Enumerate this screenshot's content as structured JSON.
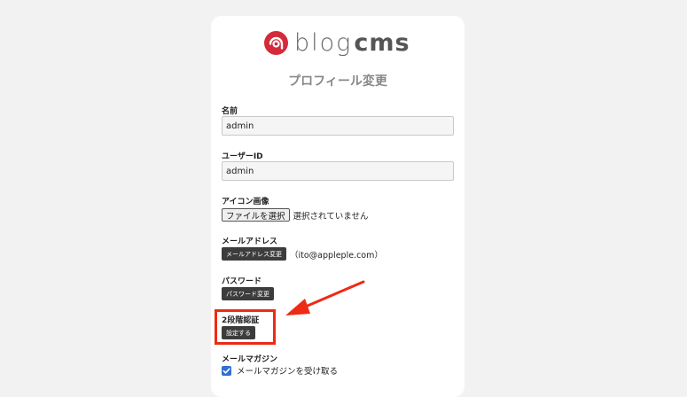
{
  "brand": {
    "blog": "blog",
    "cms": "cms"
  },
  "page": {
    "title": "プロフィール変更"
  },
  "fields": {
    "name": {
      "label": "名前",
      "value": "admin"
    },
    "user_id": {
      "label": "ユーザーID",
      "value": "admin"
    },
    "icon_image": {
      "label": "アイコン画像",
      "button": "ファイルを選択",
      "status": "選択されていません"
    },
    "email": {
      "label": "メールアドレス",
      "button": "メールアドレス変更",
      "value": "（ito@appleple.com）"
    },
    "password": {
      "label": "パスワード",
      "button": "パスワード変更"
    },
    "two_factor": {
      "label": "2段階認証",
      "button": "設定する"
    },
    "newsletter": {
      "label": "メールマガジン",
      "checkbox_label": "メールマガジンを受け取る",
      "checked": true
    }
  },
  "colors": {
    "brand_red": "#d42a3a",
    "annotation_red": "#ee2b14",
    "checkbox_blue": "#2f6fd6"
  }
}
